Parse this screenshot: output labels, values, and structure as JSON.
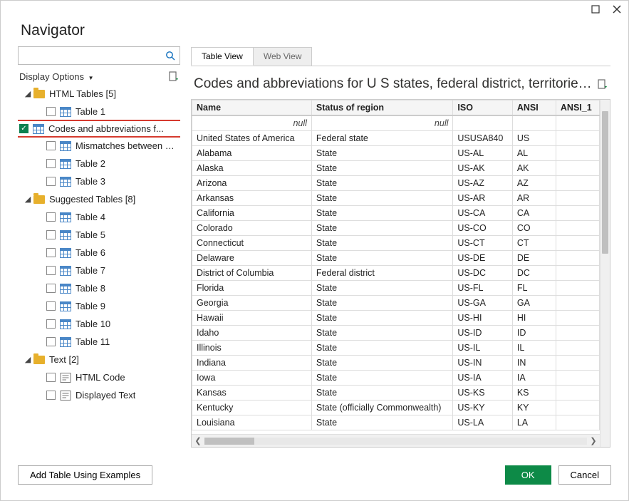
{
  "window": {
    "title": "Navigator",
    "maximize_icon": "maximize",
    "close_icon": "close"
  },
  "left_panel": {
    "search_placeholder": "",
    "display_options_label": "Display Options",
    "refresh_icon": "refresh",
    "groups": [
      {
        "label": "HTML Tables [5]",
        "items": [
          {
            "label": "Table 1",
            "checked": false,
            "icon": "table",
            "highlighted": false
          },
          {
            "label": "Codes and abbreviations f...",
            "checked": true,
            "icon": "table",
            "highlighted": true
          },
          {
            "label": "Mismatches between USP...",
            "checked": false,
            "icon": "table",
            "highlighted": false
          },
          {
            "label": "Table 2",
            "checked": false,
            "icon": "table",
            "highlighted": false
          },
          {
            "label": "Table 3",
            "checked": false,
            "icon": "table",
            "highlighted": false
          }
        ]
      },
      {
        "label": "Suggested Tables [8]",
        "items": [
          {
            "label": "Table 4",
            "checked": false,
            "icon": "table"
          },
          {
            "label": "Table 5",
            "checked": false,
            "icon": "table"
          },
          {
            "label": "Table 6",
            "checked": false,
            "icon": "table"
          },
          {
            "label": "Table 7",
            "checked": false,
            "icon": "table"
          },
          {
            "label": "Table 8",
            "checked": false,
            "icon": "table"
          },
          {
            "label": "Table 9",
            "checked": false,
            "icon": "table"
          },
          {
            "label": "Table 10",
            "checked": false,
            "icon": "table"
          },
          {
            "label": "Table 11",
            "checked": false,
            "icon": "table"
          }
        ]
      },
      {
        "label": "Text [2]",
        "items": [
          {
            "label": "HTML Code",
            "checked": false,
            "icon": "text"
          },
          {
            "label": "Displayed Text",
            "checked": false,
            "icon": "text"
          }
        ]
      }
    ]
  },
  "right_panel": {
    "tabs": [
      {
        "label": "Table View",
        "active": true
      },
      {
        "label": "Web View",
        "active": false
      }
    ],
    "preview_title": "Codes and abbreviations for U S states, federal district, territories,...",
    "refresh_icon": "refresh",
    "columns": [
      "Name",
      "Status of region",
      "ISO",
      "ANSI",
      "ANSI_1"
    ],
    "null_label": "null",
    "rows": [
      [
        "United States of America",
        "Federal state",
        "USUSA840",
        "US",
        ""
      ],
      [
        "Alabama",
        "State",
        "US-AL",
        "AL",
        ""
      ],
      [
        "Alaska",
        "State",
        "US-AK",
        "AK",
        ""
      ],
      [
        "Arizona",
        "State",
        "US-AZ",
        "AZ",
        ""
      ],
      [
        "Arkansas",
        "State",
        "US-AR",
        "AR",
        ""
      ],
      [
        "California",
        "State",
        "US-CA",
        "CA",
        ""
      ],
      [
        "Colorado",
        "State",
        "US-CO",
        "CO",
        ""
      ],
      [
        "Connecticut",
        "State",
        "US-CT",
        "CT",
        ""
      ],
      [
        "Delaware",
        "State",
        "US-DE",
        "DE",
        ""
      ],
      [
        "District of Columbia",
        "Federal district",
        "US-DC",
        "DC",
        ""
      ],
      [
        "Florida",
        "State",
        "US-FL",
        "FL",
        ""
      ],
      [
        "Georgia",
        "State",
        "US-GA",
        "GA",
        ""
      ],
      [
        "Hawaii",
        "State",
        "US-HI",
        "HI",
        ""
      ],
      [
        "Idaho",
        "State",
        "US-ID",
        "ID",
        ""
      ],
      [
        "Illinois",
        "State",
        "US-IL",
        "IL",
        ""
      ],
      [
        "Indiana",
        "State",
        "US-IN",
        "IN",
        ""
      ],
      [
        "Iowa",
        "State",
        "US-IA",
        "IA",
        ""
      ],
      [
        "Kansas",
        "State",
        "US-KS",
        "KS",
        ""
      ],
      [
        "Kentucky",
        "State (officially Commonwealth)",
        "US-KY",
        "KY",
        ""
      ],
      [
        "Louisiana",
        "State",
        "US-LA",
        "LA",
        ""
      ]
    ]
  },
  "footer": {
    "add_table_label": "Add Table Using Examples",
    "ok_label": "OK",
    "cancel_label": "Cancel"
  }
}
